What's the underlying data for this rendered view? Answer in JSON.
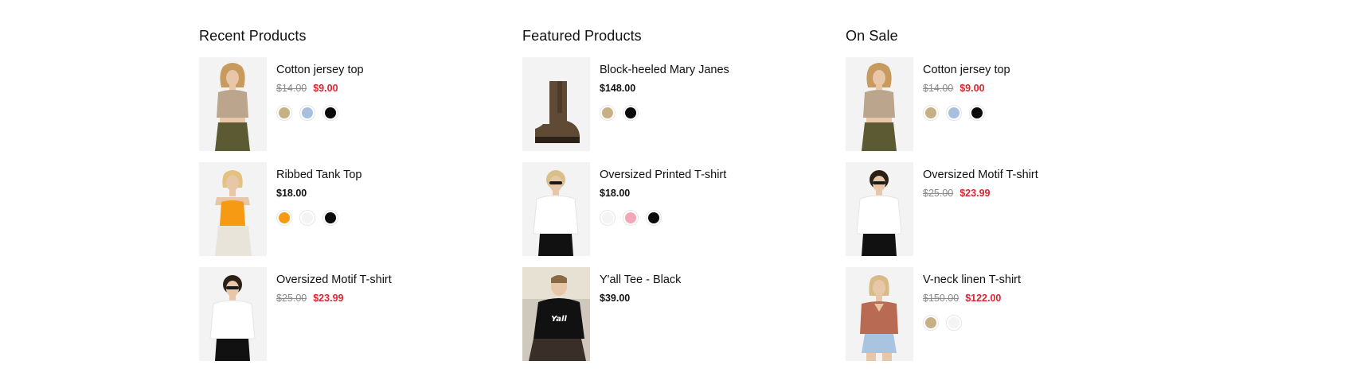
{
  "colors": {
    "sale": "#e0232e",
    "old_price": "#8a8a8a",
    "thumb_bg": "#f3f3f3"
  },
  "columns": [
    {
      "title": "Recent Products",
      "products": [
        {
          "name": "Cotton jersey top",
          "old_price": "$14.00",
          "price": "$9.00",
          "on_sale": true,
          "swatches": [
            "#c8b085",
            "#a9bfde",
            "#0a0a0a"
          ],
          "image": "woman-beige-top"
        },
        {
          "name": "Ribbed Tank Top",
          "old_price": "",
          "price": "$18.00",
          "on_sale": false,
          "swatches": [
            "#f59a12",
            "#f4f4f4",
            "#0a0a0a"
          ],
          "image": "woman-orange-tank"
        },
        {
          "name": "Oversized Motif T-shirt",
          "old_price": "$25.00",
          "price": "$23.99",
          "on_sale": true,
          "swatches": [],
          "image": "woman-white-tee"
        }
      ]
    },
    {
      "title": "Featured Products",
      "products": [
        {
          "name": "Block-heeled Mary Janes",
          "old_price": "",
          "price": "$148.00",
          "on_sale": false,
          "swatches": [
            "#c8b085",
            "#0a0a0a"
          ],
          "image": "brown-boot"
        },
        {
          "name": "Oversized Printed T-shirt",
          "old_price": "",
          "price": "$18.00",
          "on_sale": false,
          "swatches": [
            "#f4f4f4",
            "#f2a8b8",
            "#0a0a0a"
          ],
          "image": "woman-white-tee-sunglasses"
        },
        {
          "name": "Y'all Tee - Black",
          "old_price": "",
          "price": "$39.00",
          "on_sale": false,
          "swatches": [],
          "image": "man-black-tee"
        }
      ]
    },
    {
      "title": "On Sale",
      "products": [
        {
          "name": "Cotton jersey top",
          "old_price": "$14.00",
          "price": "$9.00",
          "on_sale": true,
          "swatches": [
            "#c8b085",
            "#a9bfde",
            "#0a0a0a"
          ],
          "image": "woman-beige-top"
        },
        {
          "name": "Oversized Motif T-shirt",
          "old_price": "$25.00",
          "price": "$23.99",
          "on_sale": true,
          "swatches": [],
          "image": "woman-white-tee"
        },
        {
          "name": "V-neck linen T-shirt",
          "old_price": "$150.00",
          "price": "$122.00",
          "on_sale": true,
          "swatches": [
            "#c8b085",
            "#f4f4f4"
          ],
          "image": "woman-rust-vneck"
        }
      ]
    }
  ]
}
